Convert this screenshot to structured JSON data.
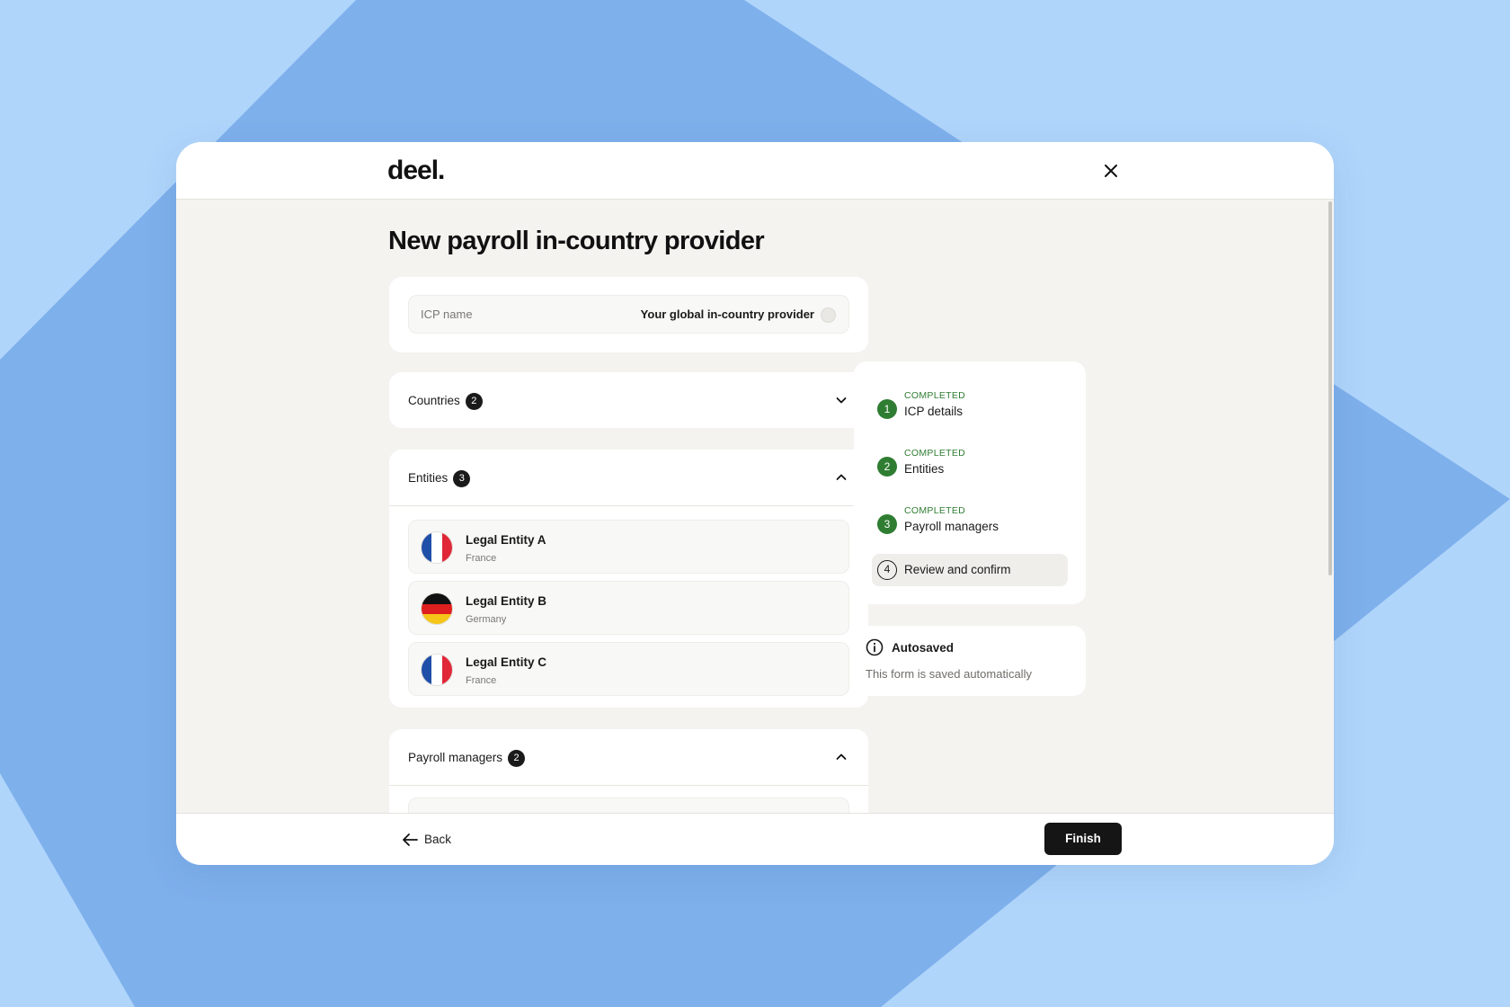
{
  "app": {
    "logo": "deel.",
    "page_title": "New payroll in-country provider"
  },
  "icp": {
    "label": "ICP name",
    "value": "Your global in-country provider"
  },
  "sections": {
    "countries": {
      "label": "Countries",
      "count": "2",
      "expanded": false
    },
    "entities": {
      "label": "Entities",
      "count": "3",
      "expanded": true,
      "items": [
        {
          "name": "Legal Entity A",
          "country": "France",
          "flag": "france-flag"
        },
        {
          "name": "Legal Entity B",
          "country": "Germany",
          "flag": "germany-flag"
        },
        {
          "name": "Legal Entity C",
          "country": "France",
          "flag": "france-flag"
        }
      ]
    },
    "payroll_managers": {
      "label": "Payroll managers",
      "count": "2",
      "expanded": true
    }
  },
  "steps": [
    {
      "number": "1",
      "status": "COMPLETED",
      "label": "ICP details"
    },
    {
      "number": "2",
      "status": "COMPLETED",
      "label": "Entities"
    },
    {
      "number": "3",
      "status": "COMPLETED",
      "label": "Payroll managers"
    },
    {
      "number": "4",
      "status": "",
      "label": "Review and confirm"
    }
  ],
  "autosave": {
    "title": "Autosaved",
    "description": "This form is saved automatically"
  },
  "footer": {
    "back_label": "Back",
    "finish_label": "Finish"
  },
  "colors": {
    "background": "#b0d5fb",
    "background_shape": "#7eb0ec",
    "accent_green": "#2f7d32",
    "primary_button": "#151515",
    "france_blue": "#1f4fa8",
    "france_red": "#e02738",
    "germany_black": "#111111",
    "germany_red": "#dd1f1f",
    "germany_gold": "#f5c518"
  },
  "icons": {
    "close": "close-icon",
    "chevron_down": "chevron-down-icon",
    "chevron_up": "chevron-up-icon",
    "info": "info-icon",
    "back": "arrow-left-icon"
  }
}
